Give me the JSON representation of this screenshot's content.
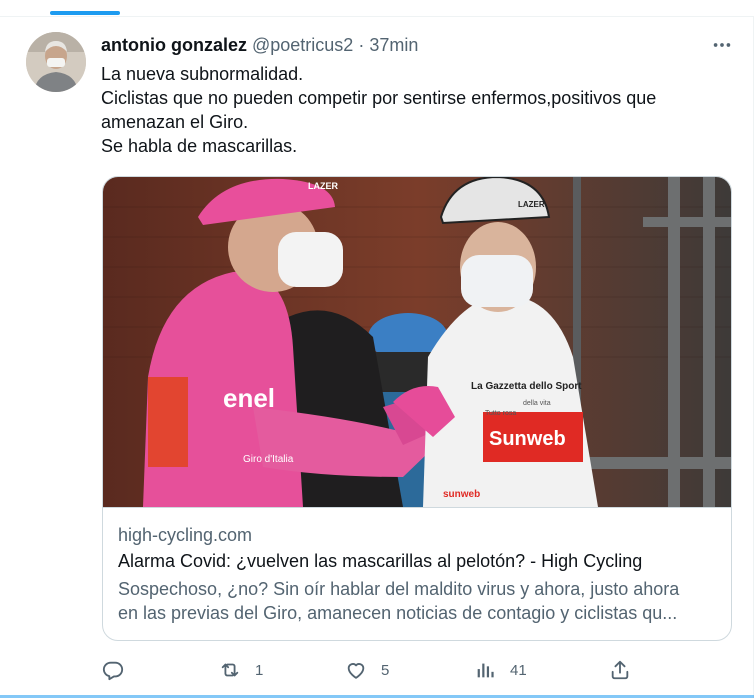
{
  "tweet": {
    "author": {
      "name": "antonio gonzalez",
      "handle": "@poetricus2",
      "separator": "·",
      "time": "37min"
    },
    "text_lines": [
      "La nueva subnormalidad.",
      "Ciclistas que no pueden competir por sentirse enfermos,positivos que",
      "amenazan el Giro.",
      "Se habla de mascarillas."
    ],
    "card": {
      "domain": "high-cycling.com",
      "title": "Alarma Covid: ¿vuelven las mascarillas al pelotón? - High Cycling",
      "description_lines": [
        "Sospechoso, ¿no? Sin oír hablar del maldito virus y ahora, justo ahora",
        "en las previas del Giro, amanecen noticias de contagio y ciclistas qu..."
      ],
      "image_text": {
        "helmet_left": "LAZER",
        "helmet_right": "LAZER",
        "left_jersey_brand": "enel",
        "left_jersey_sponsor": "Giro d'Italia",
        "right_jersey_top": "La Gazzetta dello Sport",
        "right_jersey_small": "Tutto rosa",
        "right_jersey_vita": "della vita",
        "right_jersey_main": "Sunweb",
        "right_sleeve": "sunweb"
      }
    },
    "actions": {
      "reply_count": "",
      "retweet_count": "1",
      "like_count": "5",
      "views_count": "41"
    }
  },
  "colors": {
    "accent": "#1d9bf0",
    "text_primary": "#0f1419",
    "text_secondary": "#536471",
    "border": "#cfd9de"
  },
  "icons": {
    "more": "more-horizontal-icon",
    "reply": "reply-icon",
    "retweet": "retweet-icon",
    "like": "heart-icon",
    "views": "views-icon",
    "share": "share-icon"
  }
}
